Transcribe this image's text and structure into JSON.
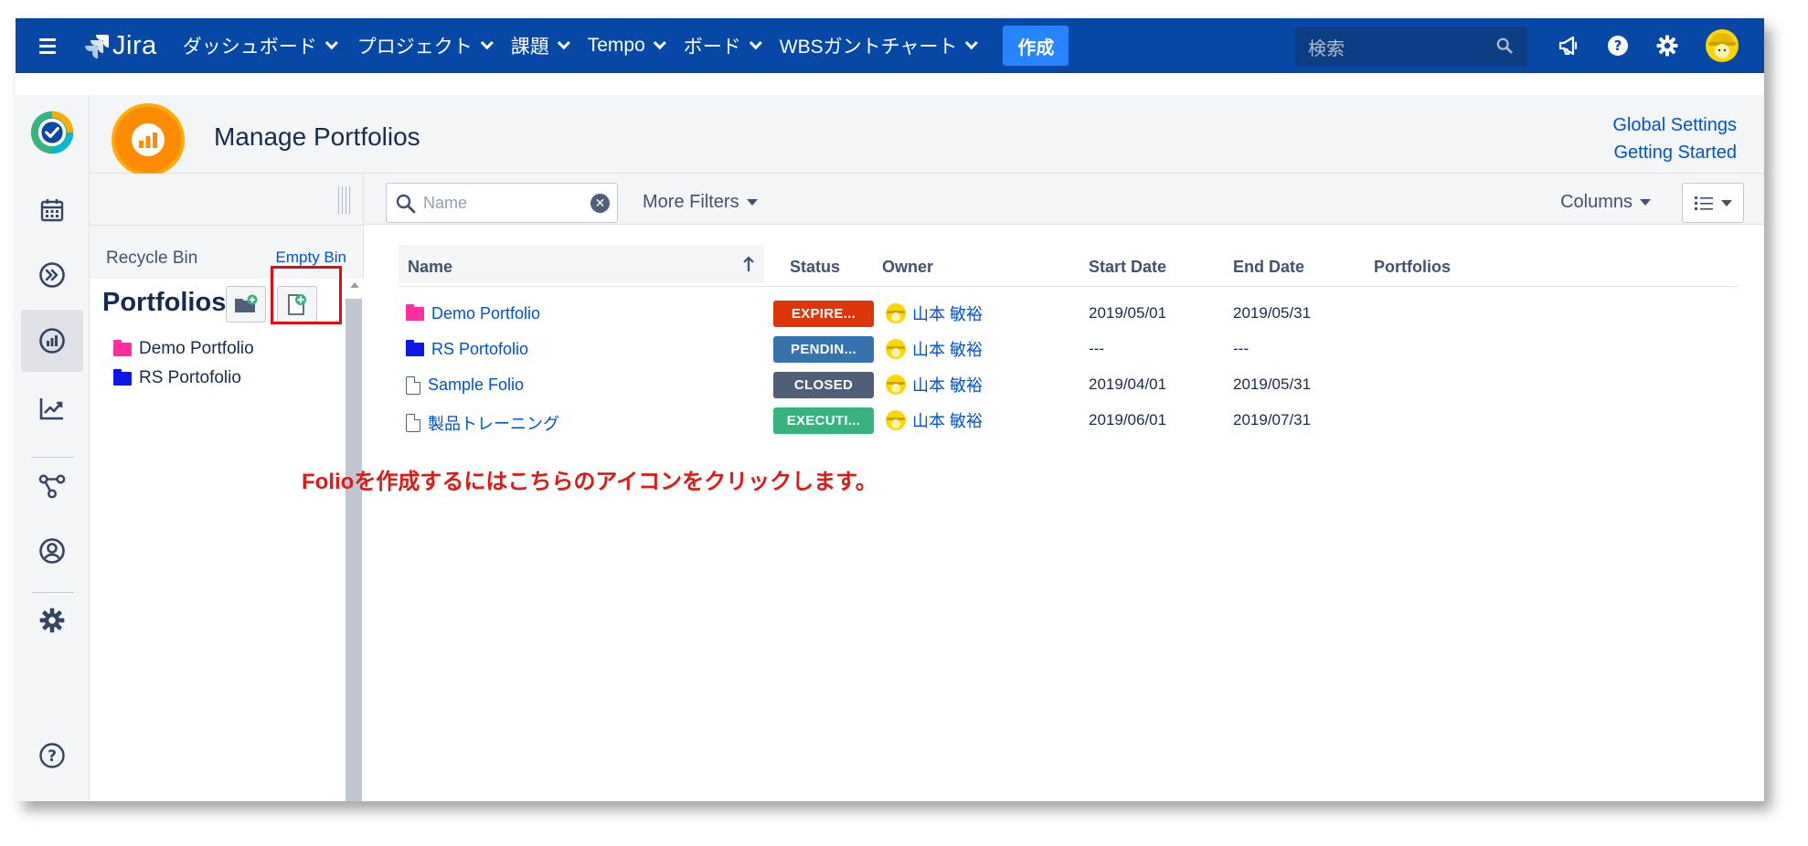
{
  "nav": {
    "logo_text": "Jira",
    "items": [
      {
        "label": "ダッシュボード"
      },
      {
        "label": "プロジェクト"
      },
      {
        "label": "課題"
      },
      {
        "label": "Tempo"
      },
      {
        "label": "ボード"
      },
      {
        "label": "WBSガントチャート"
      }
    ],
    "create_label": "作成",
    "search_placeholder": "検索",
    "icons": [
      "menu-icon",
      "megaphone-icon",
      "help-icon",
      "settings-icon",
      "user-avatar"
    ],
    "bg_color": "#0747a6",
    "create_color": "#2684ff"
  },
  "leftbar": {
    "icons": [
      "app-check-logo",
      "calendar-icon",
      "chevrons-icon",
      "portfolio-icon",
      "chart-icon",
      "network-icon",
      "user-circle-icon",
      "gear-icon",
      "help-icon"
    ],
    "active": "portfolio-icon"
  },
  "header": {
    "title": "Manage Portfolios",
    "links": {
      "global_settings": "Global Settings",
      "getting_started": "Getting Started"
    }
  },
  "pfside": {
    "recycle_bin": "Recycle Bin",
    "empty_bin": "Empty Bin",
    "title": "Portfolios",
    "tree": [
      {
        "label": "Demo Portfolio",
        "color": "#ff2fa0"
      },
      {
        "label": "RS Portofolio",
        "color": "#0b18e8"
      }
    ]
  },
  "toolbar": {
    "name_placeholder": "Name",
    "more_filters": "More Filters",
    "columns": "Columns"
  },
  "table": {
    "headers": {
      "name": "Name",
      "status": "Status",
      "owner": "Owner",
      "start_date": "Start Date",
      "end_date": "End Date",
      "portfolios": "Portfolios"
    },
    "rows": [
      {
        "name": "Demo Portfolio",
        "icon": "folder",
        "icon_color": "#ff2fa0",
        "status": "EXPIRE...",
        "status_color": "#de350b",
        "owner": "山本 敏裕",
        "start": "2019/05/01",
        "end": "2019/05/31",
        "portfolios": ""
      },
      {
        "name": "RS Portofolio",
        "icon": "folder",
        "icon_color": "#0b18e8",
        "status": "PENDIN...",
        "status_color": "#3572b0",
        "owner": "山本 敏裕",
        "start": "---",
        "end": "---",
        "portfolios": ""
      },
      {
        "name": "Sample Folio",
        "icon": "document",
        "icon_color": "#505f79",
        "status": "CLOSED",
        "status_color": "#505f79",
        "owner": "山本 敏裕",
        "start": "2019/04/01",
        "end": "2019/05/31",
        "portfolios": ""
      },
      {
        "name": "製品トレーニング",
        "icon": "document",
        "icon_color": "#505f79",
        "status": "EXECUTI...",
        "status_color": "#36b37e",
        "owner": "山本 敏裕",
        "start": "2019/06/01",
        "end": "2019/07/31",
        "portfolios": ""
      }
    ]
  },
  "annotation": {
    "text": "Folioを作成するにはこちらのアイコンをクリックします。",
    "color": "#e01818"
  }
}
